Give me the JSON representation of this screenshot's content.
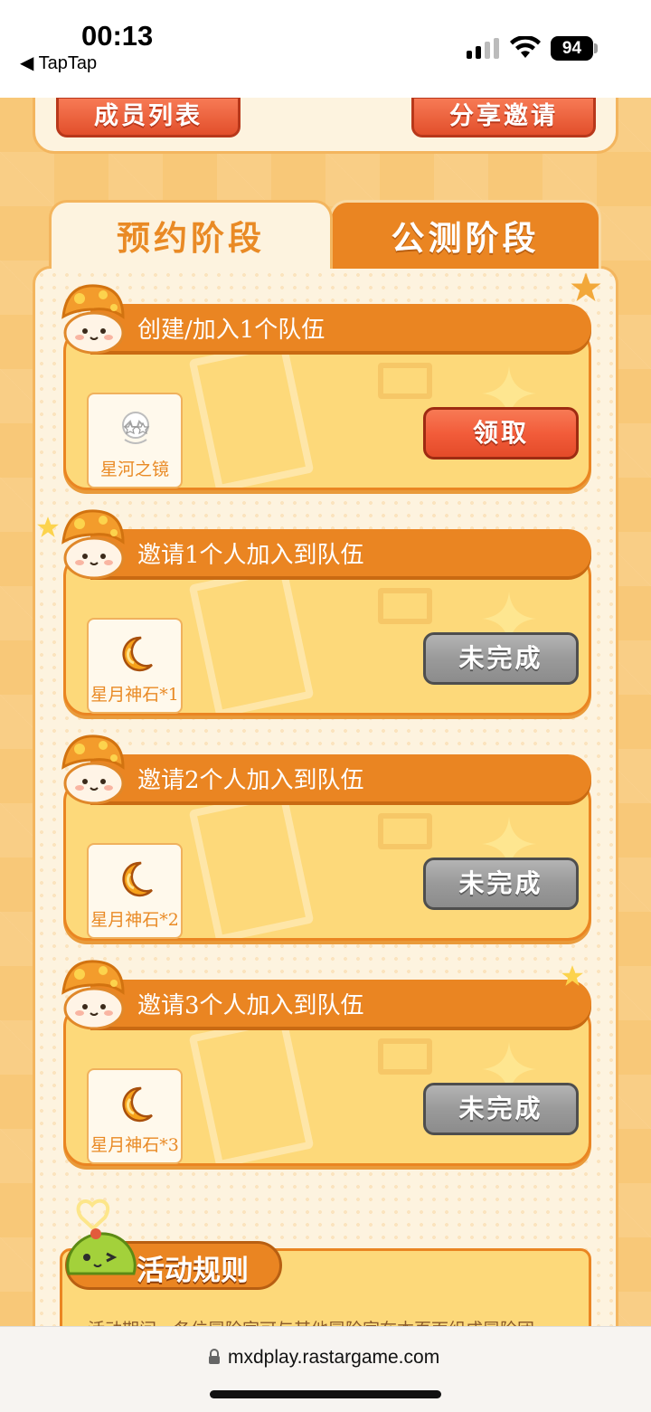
{
  "status_bar": {
    "time": "00:13",
    "back_app": "◀ TapTap",
    "battery": "94"
  },
  "top_card": {
    "members_button": "成员列表",
    "share_button": "分享邀请"
  },
  "tabs": [
    {
      "label": "预约阶段",
      "active": true
    },
    {
      "label": "公测阶段",
      "active": false
    }
  ],
  "tasks": [
    {
      "title": "创建/加入1个队伍",
      "reward_label": "星河之镜",
      "reward_icon": "star-glasses-icon",
      "action": "领取",
      "state": "claimable"
    },
    {
      "title": "邀请1个人加入到队伍",
      "reward_label": "星月神石*1",
      "reward_icon": "crescent-moon-icon",
      "action": "未完成",
      "state": "incomplete"
    },
    {
      "title": "邀请2个人加入到队伍",
      "reward_label": "星月神石*2",
      "reward_icon": "crescent-moon-icon",
      "action": "未完成",
      "state": "incomplete"
    },
    {
      "title": "邀请3个人加入到队伍",
      "reward_label": "星月神石*3",
      "reward_icon": "crescent-moon-icon",
      "action": "未完成",
      "state": "incomplete"
    }
  ],
  "rules": {
    "title": "活动规则",
    "text": "活动期间，各位冒险家可与其他冒险家在本页面组成冒险团"
  },
  "browser": {
    "url": "mxdplay.rastargame.com"
  },
  "colors": {
    "accent_orange": "#ea8522",
    "claim_red": "#f25c3a",
    "incomplete_gray": "#9a9a9a",
    "panel_cream": "#fdf3df",
    "card_yellow": "#fdd97a"
  }
}
